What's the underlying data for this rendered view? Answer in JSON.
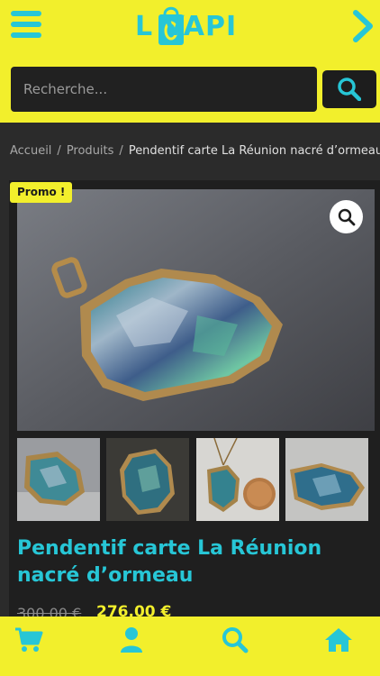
{
  "header": {
    "logo_text": "L VAPI",
    "colors": {
      "brand_yellow": "#f2ef2c",
      "brand_cyan": "#27c6d6",
      "dark": "#2b2b2b"
    },
    "icons": {
      "menu": "hamburger-menu-icon",
      "next": "chevron-right-icon",
      "logo_bag": "shopping-bag-icon"
    }
  },
  "search": {
    "placeholder": "Recherche...",
    "value": "",
    "button_icon": "search-icon"
  },
  "breadcrumb": {
    "items": [
      "Accueil",
      "Produits"
    ],
    "separator": "/",
    "current": "Pendentif carte La Réunion nacré d’ormeau"
  },
  "product": {
    "badge": "Promo !",
    "title": "Pendentif carte La Réunion nacré d’ormeau",
    "old_price": "300,00 €",
    "price": "276,00 €",
    "zoom_icon": "magnifier-icon",
    "thumbnails": 4
  },
  "bottom_nav": {
    "tabs": [
      {
        "icon": "cart-icon"
      },
      {
        "icon": "user-icon"
      },
      {
        "icon": "search-icon"
      },
      {
        "icon": "home-icon"
      }
    ]
  }
}
